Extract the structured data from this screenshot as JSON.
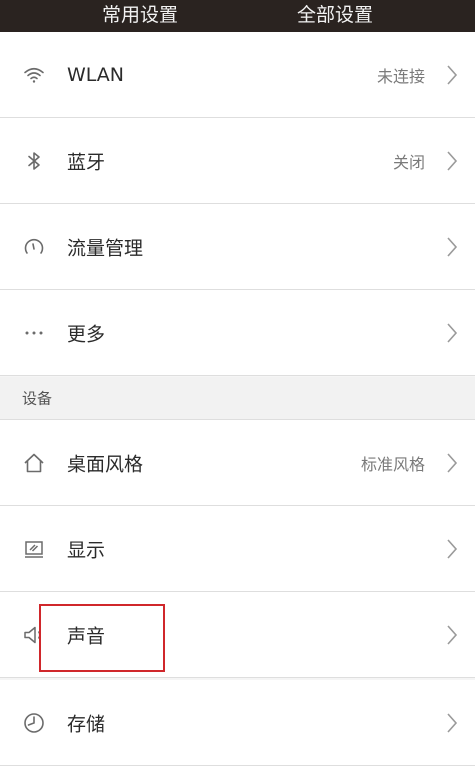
{
  "header": {
    "tabs": [
      {
        "label": "常用设置"
      },
      {
        "label": "全部设置"
      }
    ]
  },
  "rows": [
    {
      "label": "WLAN",
      "value": "未连接",
      "icon": "wifi-icon"
    },
    {
      "label": "蓝牙",
      "value": "关闭",
      "icon": "bluetooth-icon"
    },
    {
      "label": "流量管理",
      "value": "",
      "icon": "gauge-icon"
    },
    {
      "label": "更多",
      "value": "",
      "icon": "more-dots-icon"
    }
  ],
  "section": {
    "title": "设备"
  },
  "device_rows": [
    {
      "label": "桌面风格",
      "value": "标准风格",
      "icon": "home-icon"
    },
    {
      "label": "显示",
      "value": "",
      "icon": "display-icon"
    },
    {
      "label": "声音",
      "value": "",
      "icon": "speaker-icon"
    },
    {
      "label": "存储",
      "value": "",
      "icon": "storage-icon"
    }
  ],
  "colors": {
    "header_bg": "#2a2320",
    "highlight_border": "#d0272b"
  }
}
